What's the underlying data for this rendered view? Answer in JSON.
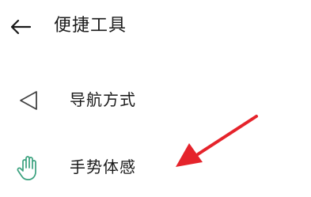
{
  "header": {
    "back_icon": "back-arrow-icon",
    "title": "便捷工具"
  },
  "menu": {
    "items": [
      {
        "label": "导航方式",
        "icon": "navigation-triangle-icon"
      },
      {
        "label": "手势体感",
        "icon": "hand-gesture-icon"
      }
    ]
  },
  "annotation": {
    "arrow_color": "#e5232b"
  },
  "colors": {
    "text": "#1a1a1a",
    "icon_gray": "#444444",
    "icon_green": "#3aa17e",
    "background": "#ffffff"
  }
}
